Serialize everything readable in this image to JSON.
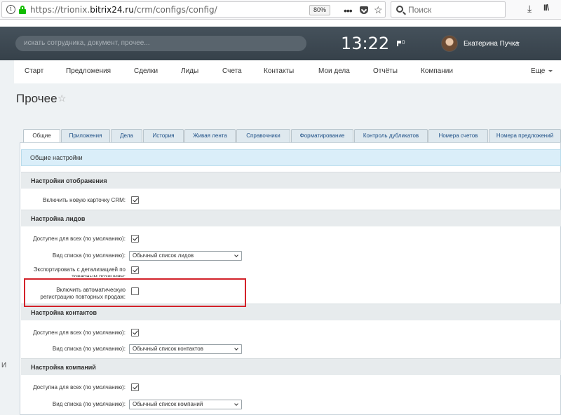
{
  "browser": {
    "url_prefix": "https://trionix.",
    "url_domain": "bitrix24.ru",
    "url_path": "/crm/configs/config/",
    "zoom": "80%",
    "search_placeholder": "Поиск",
    "info_glyph": "i",
    "dots_glyph": "•••",
    "star_glyph": "☆",
    "download_glyph": "⤓",
    "library_glyph": "II\\"
  },
  "header": {
    "search_placeholder": "искать сотрудника, документ, прочее...",
    "clock": "13:22",
    "flag_count": "0",
    "user_name": "Екатерина Пучка"
  },
  "left_edge_char": "И",
  "menu": {
    "items": [
      "Старт",
      "Предложения",
      "Сделки",
      "Лиды",
      "Счета",
      "Контакты",
      "Мои дела",
      "Отчёты",
      "Компании"
    ],
    "more": "Еще"
  },
  "page": {
    "title": "Прочее",
    "star_glyph": "☆"
  },
  "tabs": [
    "Общие",
    "Приложения",
    "Дела",
    "История",
    "Живая лента",
    "Справочники",
    "Форматирование",
    "Контроль дубликатов",
    "Номера счетов",
    "Номера предложений"
  ],
  "general": {
    "heading": "Общие настройки"
  },
  "sections": {
    "display": {
      "title": "Настройки отображения",
      "new_card_label": "Включить новую карточку CRM:",
      "new_card_checked": true
    },
    "leads": {
      "title": "Настройка лидов",
      "available_label": "Доступен для всех (по умолчанию):",
      "available_checked": true,
      "list_view_label": "Вид списка (по умолчанию):",
      "list_view_value": "Обычный список лидов",
      "export_label_1": "Экспортировать с детализацией по",
      "export_label_2": "товарным позициям:",
      "export_checked": true,
      "auto_repeat_label_1": "Включить автоматическую",
      "auto_repeat_label_2": "регистрацию повторных продаж:",
      "auto_repeat_checked": false
    },
    "contacts": {
      "title": "Настройка контактов",
      "available_label": "Доступен для всех (по умолчанию):",
      "available_checked": true,
      "list_view_label": "Вид списка (по умолчанию):",
      "list_view_value": "Обычный список контактов"
    },
    "companies": {
      "title": "Настройка компаний",
      "available_label": "Доступна для всех (по умолчанию):",
      "available_checked": true,
      "list_view_label": "Вид списка (по умолчанию):",
      "list_view_value": "Обычный список компаний"
    }
  },
  "colors": {
    "header_bg": "#3e4a54",
    "tab_text": "#1d4f86",
    "general_bar": "#daeef9",
    "highlight": "#d3222a",
    "lock_green": "#12bc00"
  }
}
